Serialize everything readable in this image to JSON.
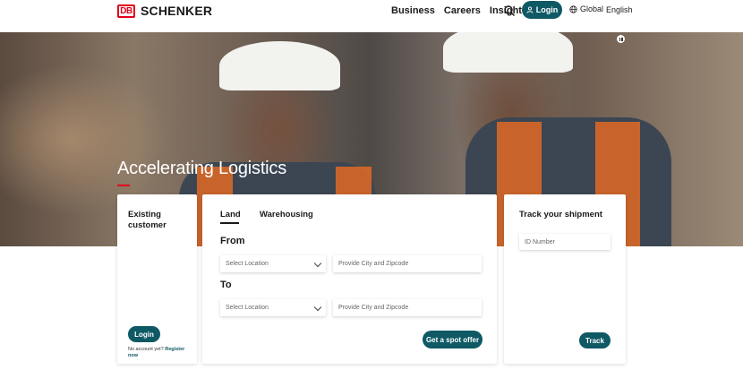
{
  "header": {
    "logo_mark": "DB",
    "logo_text": "SCHENKER",
    "nav": [
      {
        "label": "Business"
      },
      {
        "label": "Careers"
      },
      {
        "label": "Insights"
      }
    ],
    "search_icon": "search-icon",
    "login_label": "Login",
    "global_label": "Global",
    "language_label": "English"
  },
  "hero": {
    "title": "Accelerating Logistics",
    "accent_color": "#e2001a"
  },
  "customer_card": {
    "title": "Existing customer",
    "login_label": "Login",
    "register_prefix": "No account yet?",
    "register_link": "Register now"
  },
  "shipping_card": {
    "tabs": [
      {
        "label": "Land"
      },
      {
        "label": "Warehousing"
      }
    ],
    "from_label": "From",
    "to_label": "To",
    "from_select_placeholder": "Select Location",
    "from_city_placeholder": "Provide City and Zipcode",
    "to_select_placeholder": "Select Location",
    "to_city_placeholder": "Provide City and Zipcode",
    "spot_offer_label": "Get a spot offer"
  },
  "track_card": {
    "title": "Track your shipment",
    "id_placeholder": "ID Number",
    "track_label": "Track"
  },
  "colors": {
    "brand_red": "#e2001a",
    "primary_teal": "#0f5965"
  }
}
